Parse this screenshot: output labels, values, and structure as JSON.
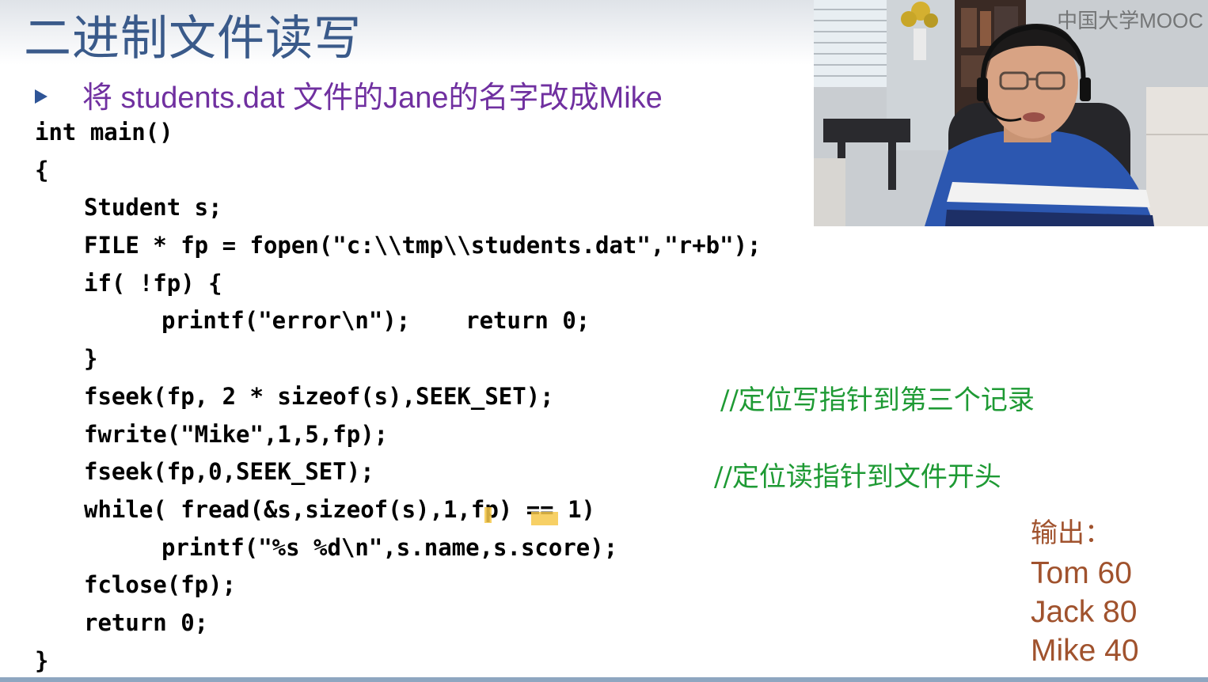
{
  "slide": {
    "title": "二进制文件读写",
    "bullet": "将 students.dat 文件的Jane的名字改成Mike"
  },
  "code": {
    "lines": [
      {
        "text": "int main()"
      },
      {
        "text": "{"
      },
      {
        "text": "Student s;"
      },
      {
        "text": "FILE * fp = fopen(\"c:\\\\tmp\\\\students.dat\",\"r+b\");"
      },
      {
        "text": "if( !fp) {"
      },
      {
        "text": "printf(\"error\\n\");    return 0;"
      },
      {
        "text": "}"
      },
      {
        "text": "fseek(fp, 2 * sizeof(s),SEEK_SET);"
      },
      {
        "text": "fwrite(\"Mike\",1,5,fp);"
      },
      {
        "text": "fseek(fp,0,SEEK_SET);"
      },
      {
        "text": "while( fread(&s,sizeof(s),1,fp) == 1)"
      },
      {
        "text": "printf(\"%s %d\\n\",s.name,s.score);"
      },
      {
        "text": "fclose(fp);"
      },
      {
        "text": "return 0;"
      },
      {
        "text": "}"
      }
    ],
    "comments": [
      "//定位写指针到第三个记录",
      "//定位读指针到文件开头"
    ]
  },
  "output": {
    "label": "输出：",
    "lines": [
      "Tom 60",
      "Jack 80",
      "Mike 40"
    ]
  },
  "webcam": {
    "watermark": "中国大学MOOC"
  },
  "colors": {
    "title": "#3a5a8a",
    "bullet": "#7030a0",
    "comment": "#1e9a34",
    "output": "#a0522d",
    "highlight": "#f6c84a"
  }
}
